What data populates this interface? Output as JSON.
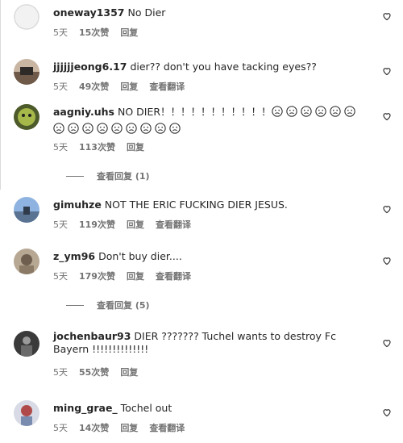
{
  "comments": [
    {
      "username": "oneway1357",
      "text": "No Dier",
      "age": "5天",
      "likes": "15次赞",
      "reply": "回复",
      "translate": ""
    },
    {
      "username": "jjjjjjeong6.17",
      "text": "dier?? don't you have tacking eyes??",
      "age": "5天",
      "likes": "49次赞",
      "reply": "回复",
      "translate": "查看翻译"
    },
    {
      "username": "aagniy.uhs",
      "text": "NO DIER！！！！！！！！！！！",
      "age": "5天",
      "likes": "113次赞",
      "reply": "回复",
      "translate": "",
      "emoji_count": 15
    },
    {
      "username": "gimuhze",
      "text": "NOT THE ERIC FUCKING DIER JESUS.",
      "age": "5天",
      "likes": "119次赞",
      "reply": "回复",
      "translate": "查看翻译"
    },
    {
      "username": "z_ym96",
      "text": "Don't buy dier....",
      "age": "5天",
      "likes": "179次赞",
      "reply": "回复",
      "translate": "查看翻译"
    },
    {
      "username": "jochenbaur93",
      "text": "DIER ??????? Tuchel wants to destroy Fc Bayern !!!!!!!!!!!!!!",
      "age": "5天",
      "likes": "55次赞",
      "reply": "回复",
      "translate": ""
    },
    {
      "username": "ming_grae_",
      "text": "Tochel out",
      "age": "5天",
      "likes": "14次赞",
      "reply": "回复",
      "translate": "查看翻译"
    }
  ],
  "view_replies": [
    {
      "label": "查看回复 (1)"
    },
    {
      "label": "查看回复 (5)"
    }
  ],
  "icons": {
    "heart": "heart-outline-icon",
    "emoji": "frowning-face-emoji"
  },
  "colors": {
    "text": "#262626",
    "muted": "#737373"
  }
}
